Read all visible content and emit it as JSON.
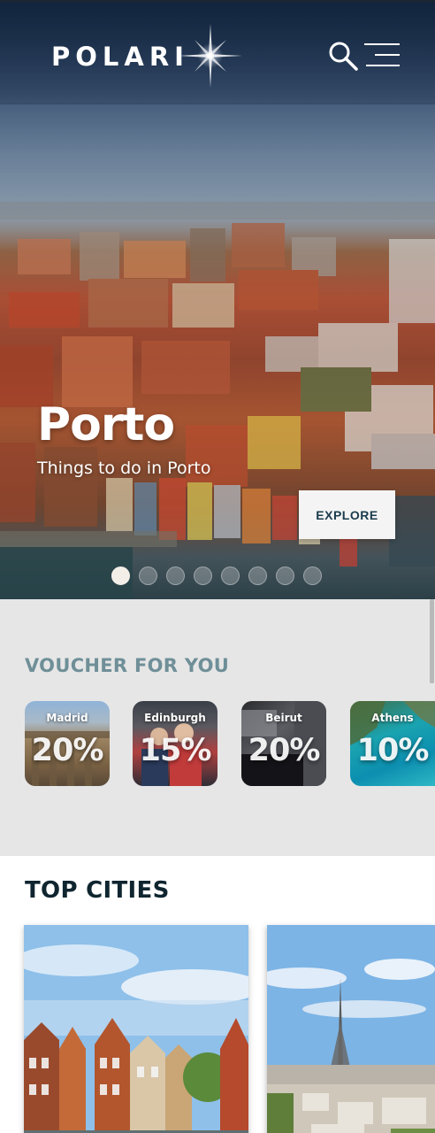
{
  "header": {
    "logo_text": "POLARI",
    "icons": [
      "logo-star-icon",
      "search-icon",
      "menu-icon"
    ]
  },
  "hero": {
    "title": "Porto",
    "subtitle": "Things to do in Porto",
    "cta_label": "EXPLORE",
    "slides_count": 8,
    "active_slide": 1
  },
  "vouchers": {
    "title": "VOUCHER FOR YOU",
    "items": [
      {
        "city": "Madrid",
        "discount": "20%"
      },
      {
        "city": "Edinburgh",
        "discount": "15%"
      },
      {
        "city": "Beirut",
        "discount": "20%"
      },
      {
        "city": "Athens",
        "discount": "10%"
      }
    ]
  },
  "top_cities": {
    "title": "TOP CITIES"
  },
  "colors": {
    "section_title": "#6f8f98",
    "heading_dark": "#0f2530",
    "button_text": "#1a3b4c"
  }
}
